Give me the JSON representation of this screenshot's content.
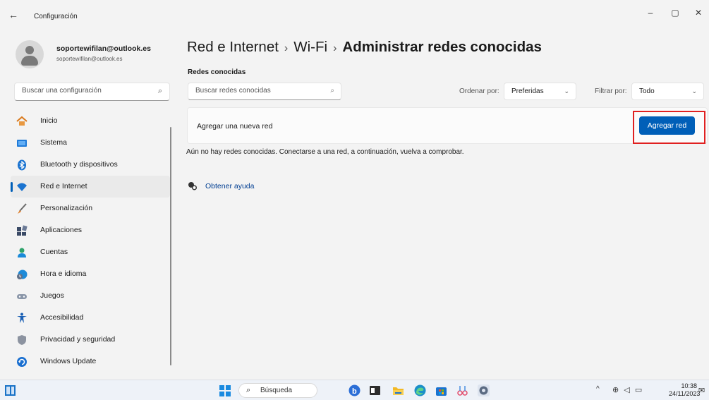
{
  "window": {
    "title": "Configuración",
    "back_glyph": "←",
    "controls": {
      "minimize": "–",
      "maximize": "▢",
      "close": "✕"
    }
  },
  "profile": {
    "name": "soportewifilan@outlook.es",
    "email": "soportewifilan@outlook.es"
  },
  "search": {
    "placeholder": "Buscar una configuración"
  },
  "sidebar": {
    "items": [
      {
        "label": "Inicio",
        "icon": "home-icon"
      },
      {
        "label": "Sistema",
        "icon": "system-icon"
      },
      {
        "label": "Bluetooth y dispositivos",
        "icon": "bluetooth-icon"
      },
      {
        "label": "Red e Internet",
        "icon": "wifi-icon",
        "active": true
      },
      {
        "label": "Personalización",
        "icon": "brush-icon"
      },
      {
        "label": "Aplicaciones",
        "icon": "apps-icon"
      },
      {
        "label": "Cuentas",
        "icon": "account-icon"
      },
      {
        "label": "Hora e idioma",
        "icon": "clock-globe-icon"
      },
      {
        "label": "Juegos",
        "icon": "gamepad-icon"
      },
      {
        "label": "Accesibilidad",
        "icon": "accessibility-icon"
      },
      {
        "label": "Privacidad y seguridad",
        "icon": "shield-icon"
      },
      {
        "label": "Windows Update",
        "icon": "update-icon"
      }
    ]
  },
  "breadcrumb": {
    "items": [
      "Red e Internet",
      "Wi-Fi",
      "Administrar redes conocidas"
    ],
    "separator": "›"
  },
  "main": {
    "section_label": "Redes conocidas",
    "search_placeholder": "Buscar redes conocidas",
    "sort_label": "Ordenar por:",
    "sort_value": "Preferidas",
    "filter_label": "Filtrar por:",
    "filter_value": "Todo",
    "add_card_text": "Agregar una nueva red",
    "add_button": "Agregar red",
    "empty_message": "Aún no hay redes conocidas. Conectarse a una red, a continuación, vuelva a comprobar.",
    "help_link": "Obtener ayuda"
  },
  "taskbar": {
    "search_label": "Búsqueda",
    "time": "10:38",
    "date": "24/11/2023",
    "tray_chevron": "^"
  },
  "colors": {
    "accent": "#005fb8",
    "highlight": "#e02020",
    "background": "#f3f3f3"
  }
}
